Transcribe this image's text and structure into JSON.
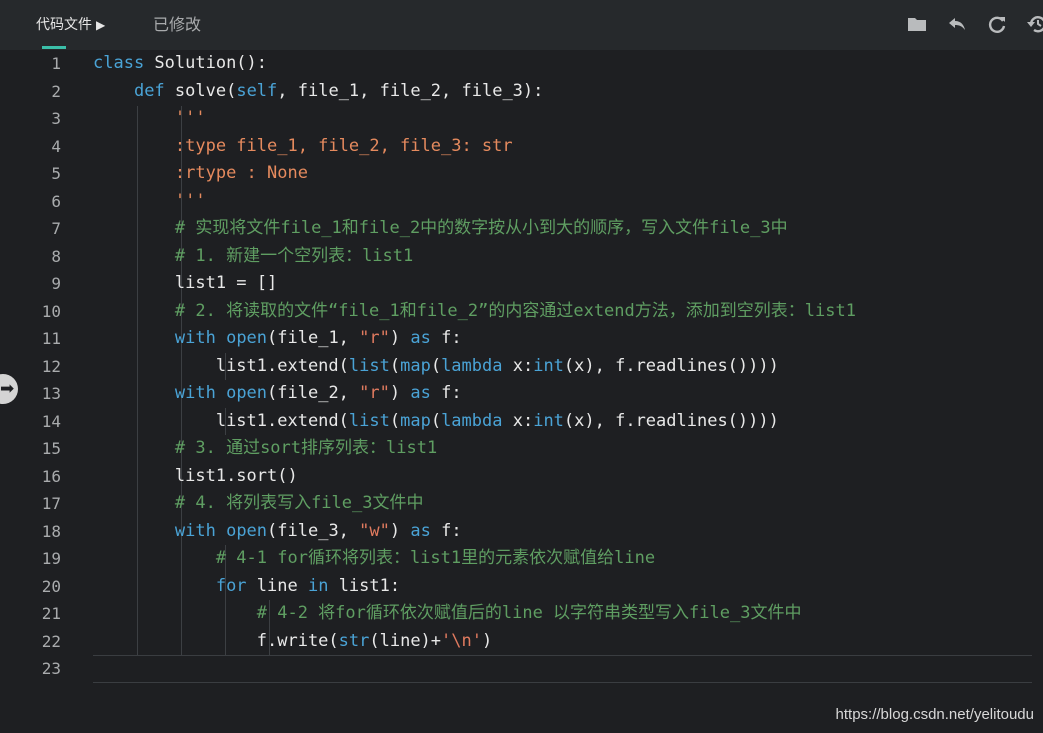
{
  "toolbar": {
    "tab_code": "代码文件",
    "tab_code_arrow": "▶",
    "tab_modified": "已修改",
    "icons": [
      "folder-icon",
      "undo-icon",
      "refresh-icon",
      "history-icon"
    ]
  },
  "editor": {
    "line_numbers": [
      "1",
      "2",
      "3",
      "4",
      "5",
      "6",
      "7",
      "8",
      "9",
      "10",
      "11",
      "12",
      "13",
      "14",
      "15",
      "16",
      "17",
      "18",
      "19",
      "20",
      "21",
      "22",
      "23"
    ],
    "lines": [
      [
        {
          "t": "class ",
          "c": "kw"
        },
        {
          "t": "Solution():",
          "c": "pl"
        }
      ],
      [
        {
          "t": "    ",
          "c": "pl"
        },
        {
          "t": "def ",
          "c": "kw"
        },
        {
          "t": "solve(",
          "c": "pl"
        },
        {
          "t": "self",
          "c": "kw"
        },
        {
          "t": ", file_1, file_2, file_3):",
          "c": "pl"
        }
      ],
      [
        {
          "t": "        ",
          "c": "pl"
        },
        {
          "t": "'''",
          "c": "doc"
        }
      ],
      [
        {
          "t": "        ",
          "c": "pl"
        },
        {
          "t": ":type file_1, file_2, file_3: str",
          "c": "doc"
        }
      ],
      [
        {
          "t": "        ",
          "c": "pl"
        },
        {
          "t": ":rtype : None",
          "c": "doc"
        }
      ],
      [
        {
          "t": "        ",
          "c": "pl"
        },
        {
          "t": "'''",
          "c": "doc"
        }
      ],
      [
        {
          "t": "        ",
          "c": "pl"
        },
        {
          "t": "# 实现将文件file_1和file_2中的数字按从小到大的顺序，写入文件file_3中",
          "c": "cm"
        }
      ],
      [
        {
          "t": "        ",
          "c": "pl"
        },
        {
          "t": "# 1. 新建一个空列表：list1",
          "c": "cm"
        }
      ],
      [
        {
          "t": "        ",
          "c": "pl"
        },
        {
          "t": "list1 = []",
          "c": "pl"
        }
      ],
      [
        {
          "t": "        ",
          "c": "pl"
        },
        {
          "t": "# 2. 将读取的文件“file_1和file_2”的内容通过extend方法，添加到空列表：list1",
          "c": "cm"
        }
      ],
      [
        {
          "t": "        ",
          "c": "pl"
        },
        {
          "t": "with ",
          "c": "kw"
        },
        {
          "t": "open",
          "c": "bi"
        },
        {
          "t": "(file_1, ",
          "c": "pl"
        },
        {
          "t": "\"r\"",
          "c": "str"
        },
        {
          "t": ") ",
          "c": "pl"
        },
        {
          "t": "as ",
          "c": "kw"
        },
        {
          "t": "f:",
          "c": "pl"
        }
      ],
      [
        {
          "t": "            ",
          "c": "pl"
        },
        {
          "t": "list1.extend(",
          "c": "pl"
        },
        {
          "t": "list",
          "c": "bi"
        },
        {
          "t": "(",
          "c": "pl"
        },
        {
          "t": "map",
          "c": "bi"
        },
        {
          "t": "(",
          "c": "pl"
        },
        {
          "t": "lambda ",
          "c": "kw"
        },
        {
          "t": "x:",
          "c": "pl"
        },
        {
          "t": "int",
          "c": "bi"
        },
        {
          "t": "(x), f.readlines())))",
          "c": "pl"
        }
      ],
      [
        {
          "t": "        ",
          "c": "pl"
        },
        {
          "t": "with ",
          "c": "kw"
        },
        {
          "t": "open",
          "c": "bi"
        },
        {
          "t": "(file_2, ",
          "c": "pl"
        },
        {
          "t": "\"r\"",
          "c": "str"
        },
        {
          "t": ") ",
          "c": "pl"
        },
        {
          "t": "as ",
          "c": "kw"
        },
        {
          "t": "f:",
          "c": "pl"
        }
      ],
      [
        {
          "t": "            ",
          "c": "pl"
        },
        {
          "t": "list1.extend(",
          "c": "pl"
        },
        {
          "t": "list",
          "c": "bi"
        },
        {
          "t": "(",
          "c": "pl"
        },
        {
          "t": "map",
          "c": "bi"
        },
        {
          "t": "(",
          "c": "pl"
        },
        {
          "t": "lambda ",
          "c": "kw"
        },
        {
          "t": "x:",
          "c": "pl"
        },
        {
          "t": "int",
          "c": "bi"
        },
        {
          "t": "(x), f.readlines())))",
          "c": "pl"
        }
      ],
      [
        {
          "t": "        ",
          "c": "pl"
        },
        {
          "t": "# 3. 通过sort排序列表：list1",
          "c": "cm"
        }
      ],
      [
        {
          "t": "        ",
          "c": "pl"
        },
        {
          "t": "list1.sort()",
          "c": "pl"
        }
      ],
      [
        {
          "t": "        ",
          "c": "pl"
        },
        {
          "t": "# 4. 将列表写入file_3文件中",
          "c": "cm"
        }
      ],
      [
        {
          "t": "        ",
          "c": "pl"
        },
        {
          "t": "with ",
          "c": "kw"
        },
        {
          "t": "open",
          "c": "bi"
        },
        {
          "t": "(file_3, ",
          "c": "pl"
        },
        {
          "t": "\"w\"",
          "c": "str"
        },
        {
          "t": ") ",
          "c": "pl"
        },
        {
          "t": "as ",
          "c": "kw"
        },
        {
          "t": "f:",
          "c": "pl"
        }
      ],
      [
        {
          "t": "            ",
          "c": "pl"
        },
        {
          "t": "# 4-1 for循环将列表：list1里的元素依次赋值给line",
          "c": "cm"
        }
      ],
      [
        {
          "t": "            ",
          "c": "pl"
        },
        {
          "t": "for ",
          "c": "kw"
        },
        {
          "t": "line ",
          "c": "pl"
        },
        {
          "t": "in ",
          "c": "kw"
        },
        {
          "t": "list1:",
          "c": "pl"
        }
      ],
      [
        {
          "t": "                ",
          "c": "pl"
        },
        {
          "t": "# 4-2 将for循环依次赋值后的line 以字符串类型写入file_3文件中",
          "c": "cm"
        }
      ],
      [
        {
          "t": "                ",
          "c": "pl"
        },
        {
          "t": "f.write(",
          "c": "pl"
        },
        {
          "t": "str",
          "c": "bi"
        },
        {
          "t": "(line)+",
          "c": "pl"
        },
        {
          "t": "'\\n'",
          "c": "str"
        },
        {
          "t": ")",
          "c": "pl"
        }
      ],
      []
    ]
  },
  "watermark": "https://blog.csdn.net/yelitoudu",
  "colors": {
    "keyword": "#4aa3d6",
    "string": "#e07a5f",
    "docstring": "#e58a5e",
    "comment": "#5f9e62",
    "text": "#e8e8e8",
    "accent": "#3bbfa9"
  }
}
